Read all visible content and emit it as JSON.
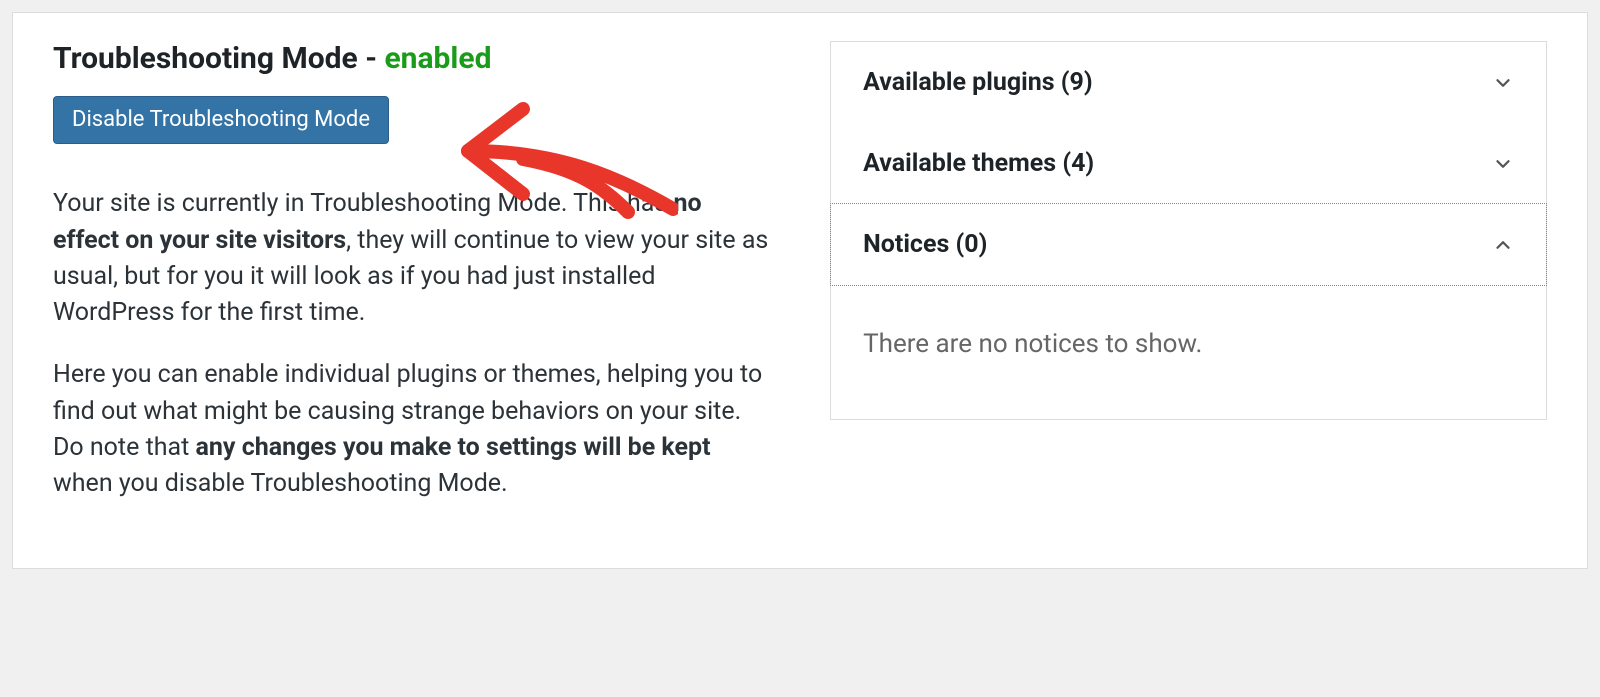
{
  "header": {
    "title_prefix": "Troubleshooting Mode",
    "dash": " - ",
    "status": "enabled"
  },
  "button": {
    "disable_label": "Disable Troubleshooting Mode"
  },
  "paragraphs": {
    "p1_a": "Your site is currently in Troubleshooting Mode. This has ",
    "p1_b": "no effect on your site visitors",
    "p1_c": ", they will continue to view your site as usual, but for you it will look as if you had just installed WordPress for the first time.",
    "p2_a": "Here you can enable individual plugins or themes, helping you to find out what might be causing strange behaviors on your site. Do note that ",
    "p2_b": "any changes you make to settings will be kept",
    "p2_c": " when you disable Troubleshooting Mode."
  },
  "accordion": {
    "plugins_label": "Available plugins (9)",
    "themes_label": "Available themes (4)",
    "notices_label": "Notices (0)",
    "notices_empty": "There are no notices to show."
  }
}
